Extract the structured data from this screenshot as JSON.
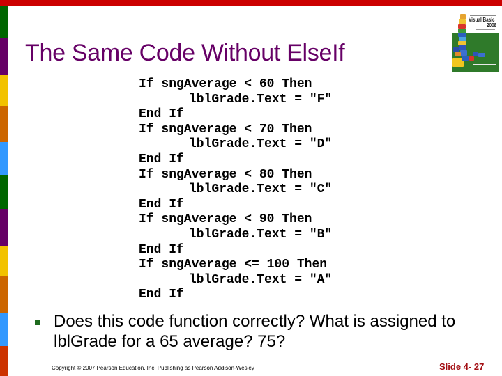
{
  "theme": {
    "top_bar_color": "#CC0000",
    "title_color": "#660066",
    "bullet_color": "#1E6B1E",
    "slide_number_color": "#A30F14",
    "stripe_colors": [
      "#006600",
      "#660066",
      "#F2C200",
      "#CC6600",
      "#3399FF",
      "#006600",
      "#660066",
      "#F2C200",
      "#CC6600",
      "#3399FF",
      "#CC3300"
    ]
  },
  "slide": {
    "title": "The Same Code Without ElseIf",
    "book_cover": {
      "icon": "book-cover-image",
      "title_line1": "Visual Basic",
      "title_line2": "2008"
    },
    "code_lines": [
      {
        "text": "If sngAverage < 60 Then",
        "indent": false
      },
      {
        "text": "lblGrade.Text = \"F\"",
        "indent": true
      },
      {
        "text": "End If",
        "indent": false
      },
      {
        "text": "If sngAverage < 70 Then",
        "indent": false
      },
      {
        "text": "lblGrade.Text = \"D\"",
        "indent": true
      },
      {
        "text": "End If",
        "indent": false
      },
      {
        "text": "If sngAverage < 80 Then",
        "indent": false
      },
      {
        "text": "lblGrade.Text = \"C\"",
        "indent": true
      },
      {
        "text": "End If",
        "indent": false
      },
      {
        "text": "If sngAverage < 90 Then",
        "indent": false
      },
      {
        "text": "lblGrade.Text = \"B\"",
        "indent": true
      },
      {
        "text": "End If",
        "indent": false
      },
      {
        "text": "If sngAverage <= 100 Then",
        "indent": false
      },
      {
        "text": "lblGrade.Text = \"A\"",
        "indent": true
      },
      {
        "text": "End If",
        "indent": false
      }
    ],
    "bullets": [
      {
        "icon": "square-bullet-icon",
        "text": "Does this code function correctly?  What is assigned to lblGrade for a 65 average?  75?"
      }
    ]
  },
  "footer": {
    "copyright": "Copyright © 2007 Pearson Education, Inc. Publishing as Pearson Addison-Wesley",
    "slide_number": "Slide 4- 27"
  }
}
